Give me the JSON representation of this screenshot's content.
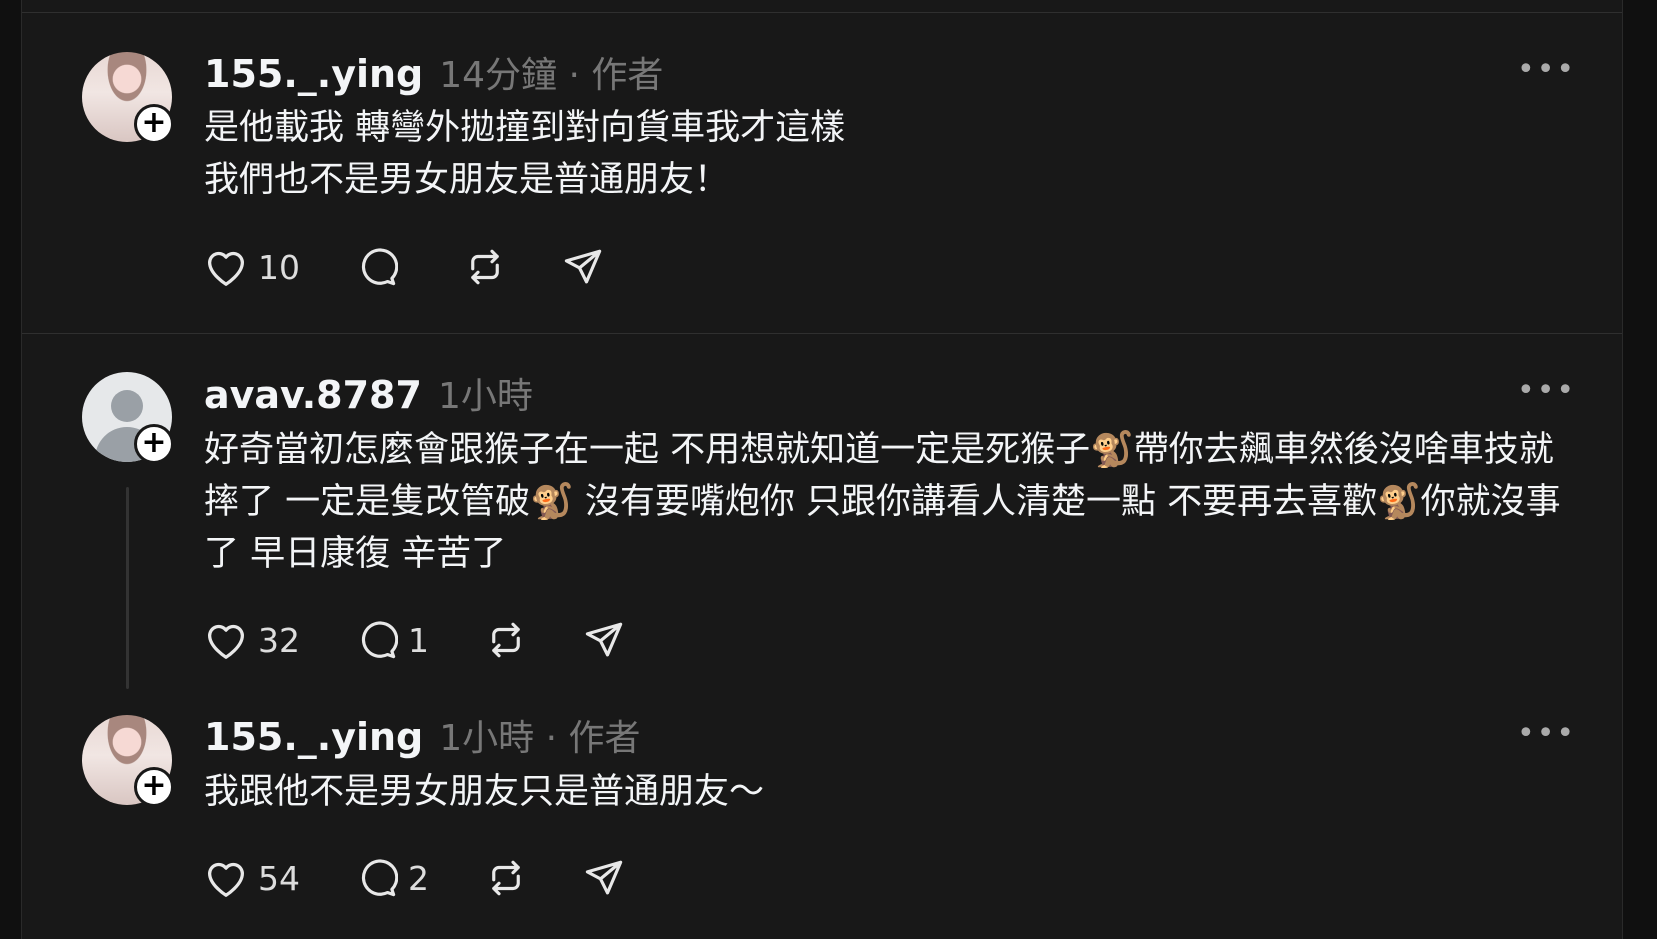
{
  "posts": [
    {
      "username": "155._.ying",
      "time": "14分鐘",
      "tag": "作者",
      "text": "是他載我 轉彎外拋撞到對向貨車我才這樣\n我們也不是男女朋友是普通朋友！",
      "likes": "10",
      "replies": ""
    },
    {
      "username": "avav.8787",
      "time": "1小時",
      "tag": "",
      "text": "好奇當初怎麼會跟猴子在一起 不用想就知道一定是死猴子🐒帶你去飆車然後沒啥車技就摔了 一定是隻改管破🐒 沒有要嘴炮你 只跟你講看人清楚一點 不要再去喜歡🐒你就沒事了 早日康復 辛苦了",
      "likes": "32",
      "replies": "1"
    },
    {
      "username": "155._.ying",
      "time": "1小時",
      "tag": "作者",
      "text": "我跟他不是男女朋友只是普通朋友～",
      "likes": "54",
      "replies": "2"
    }
  ],
  "separator": "·",
  "follow_symbol": "+",
  "more_symbol": "•••"
}
